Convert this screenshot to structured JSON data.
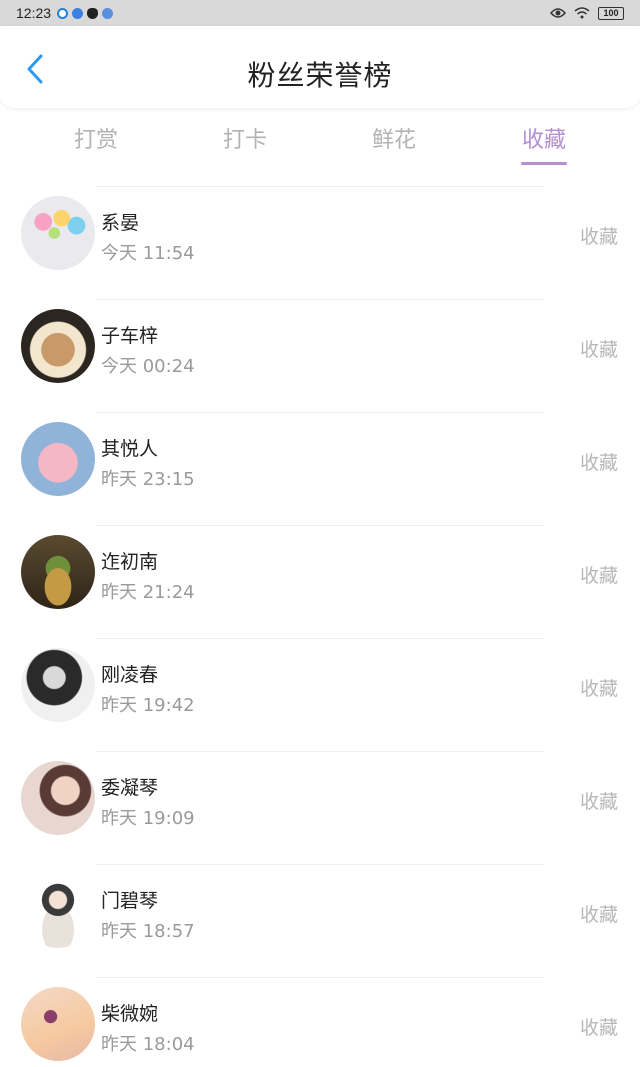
{
  "status_bar": {
    "time": "12:23",
    "battery": "100"
  },
  "header": {
    "title": "粉丝荣誉榜"
  },
  "tabs": [
    {
      "label": "打赏",
      "active": false
    },
    {
      "label": "打卡",
      "active": false
    },
    {
      "label": "鲜花",
      "active": false
    },
    {
      "label": "收藏",
      "active": true
    }
  ],
  "colors": {
    "accent": "#b48fd1",
    "back": "#2b9af3"
  },
  "fans": [
    {
      "name": "系晏",
      "time": "今天 11:54",
      "action": "收藏"
    },
    {
      "name": "子车梓",
      "time": "今天 00:24",
      "action": "收藏"
    },
    {
      "name": "其悦人",
      "time": "昨天 23:15",
      "action": "收藏"
    },
    {
      "name": "迮初南",
      "time": "昨天 21:24",
      "action": "收藏"
    },
    {
      "name": "刚凌春",
      "time": "昨天 19:42",
      "action": "收藏"
    },
    {
      "name": "委凝琴",
      "time": "昨天 19:09",
      "action": "收藏"
    },
    {
      "name": "门碧琴",
      "time": "昨天 18:57",
      "action": "收藏"
    },
    {
      "name": "柴微婉",
      "time": "昨天 18:04",
      "action": "收藏"
    }
  ]
}
